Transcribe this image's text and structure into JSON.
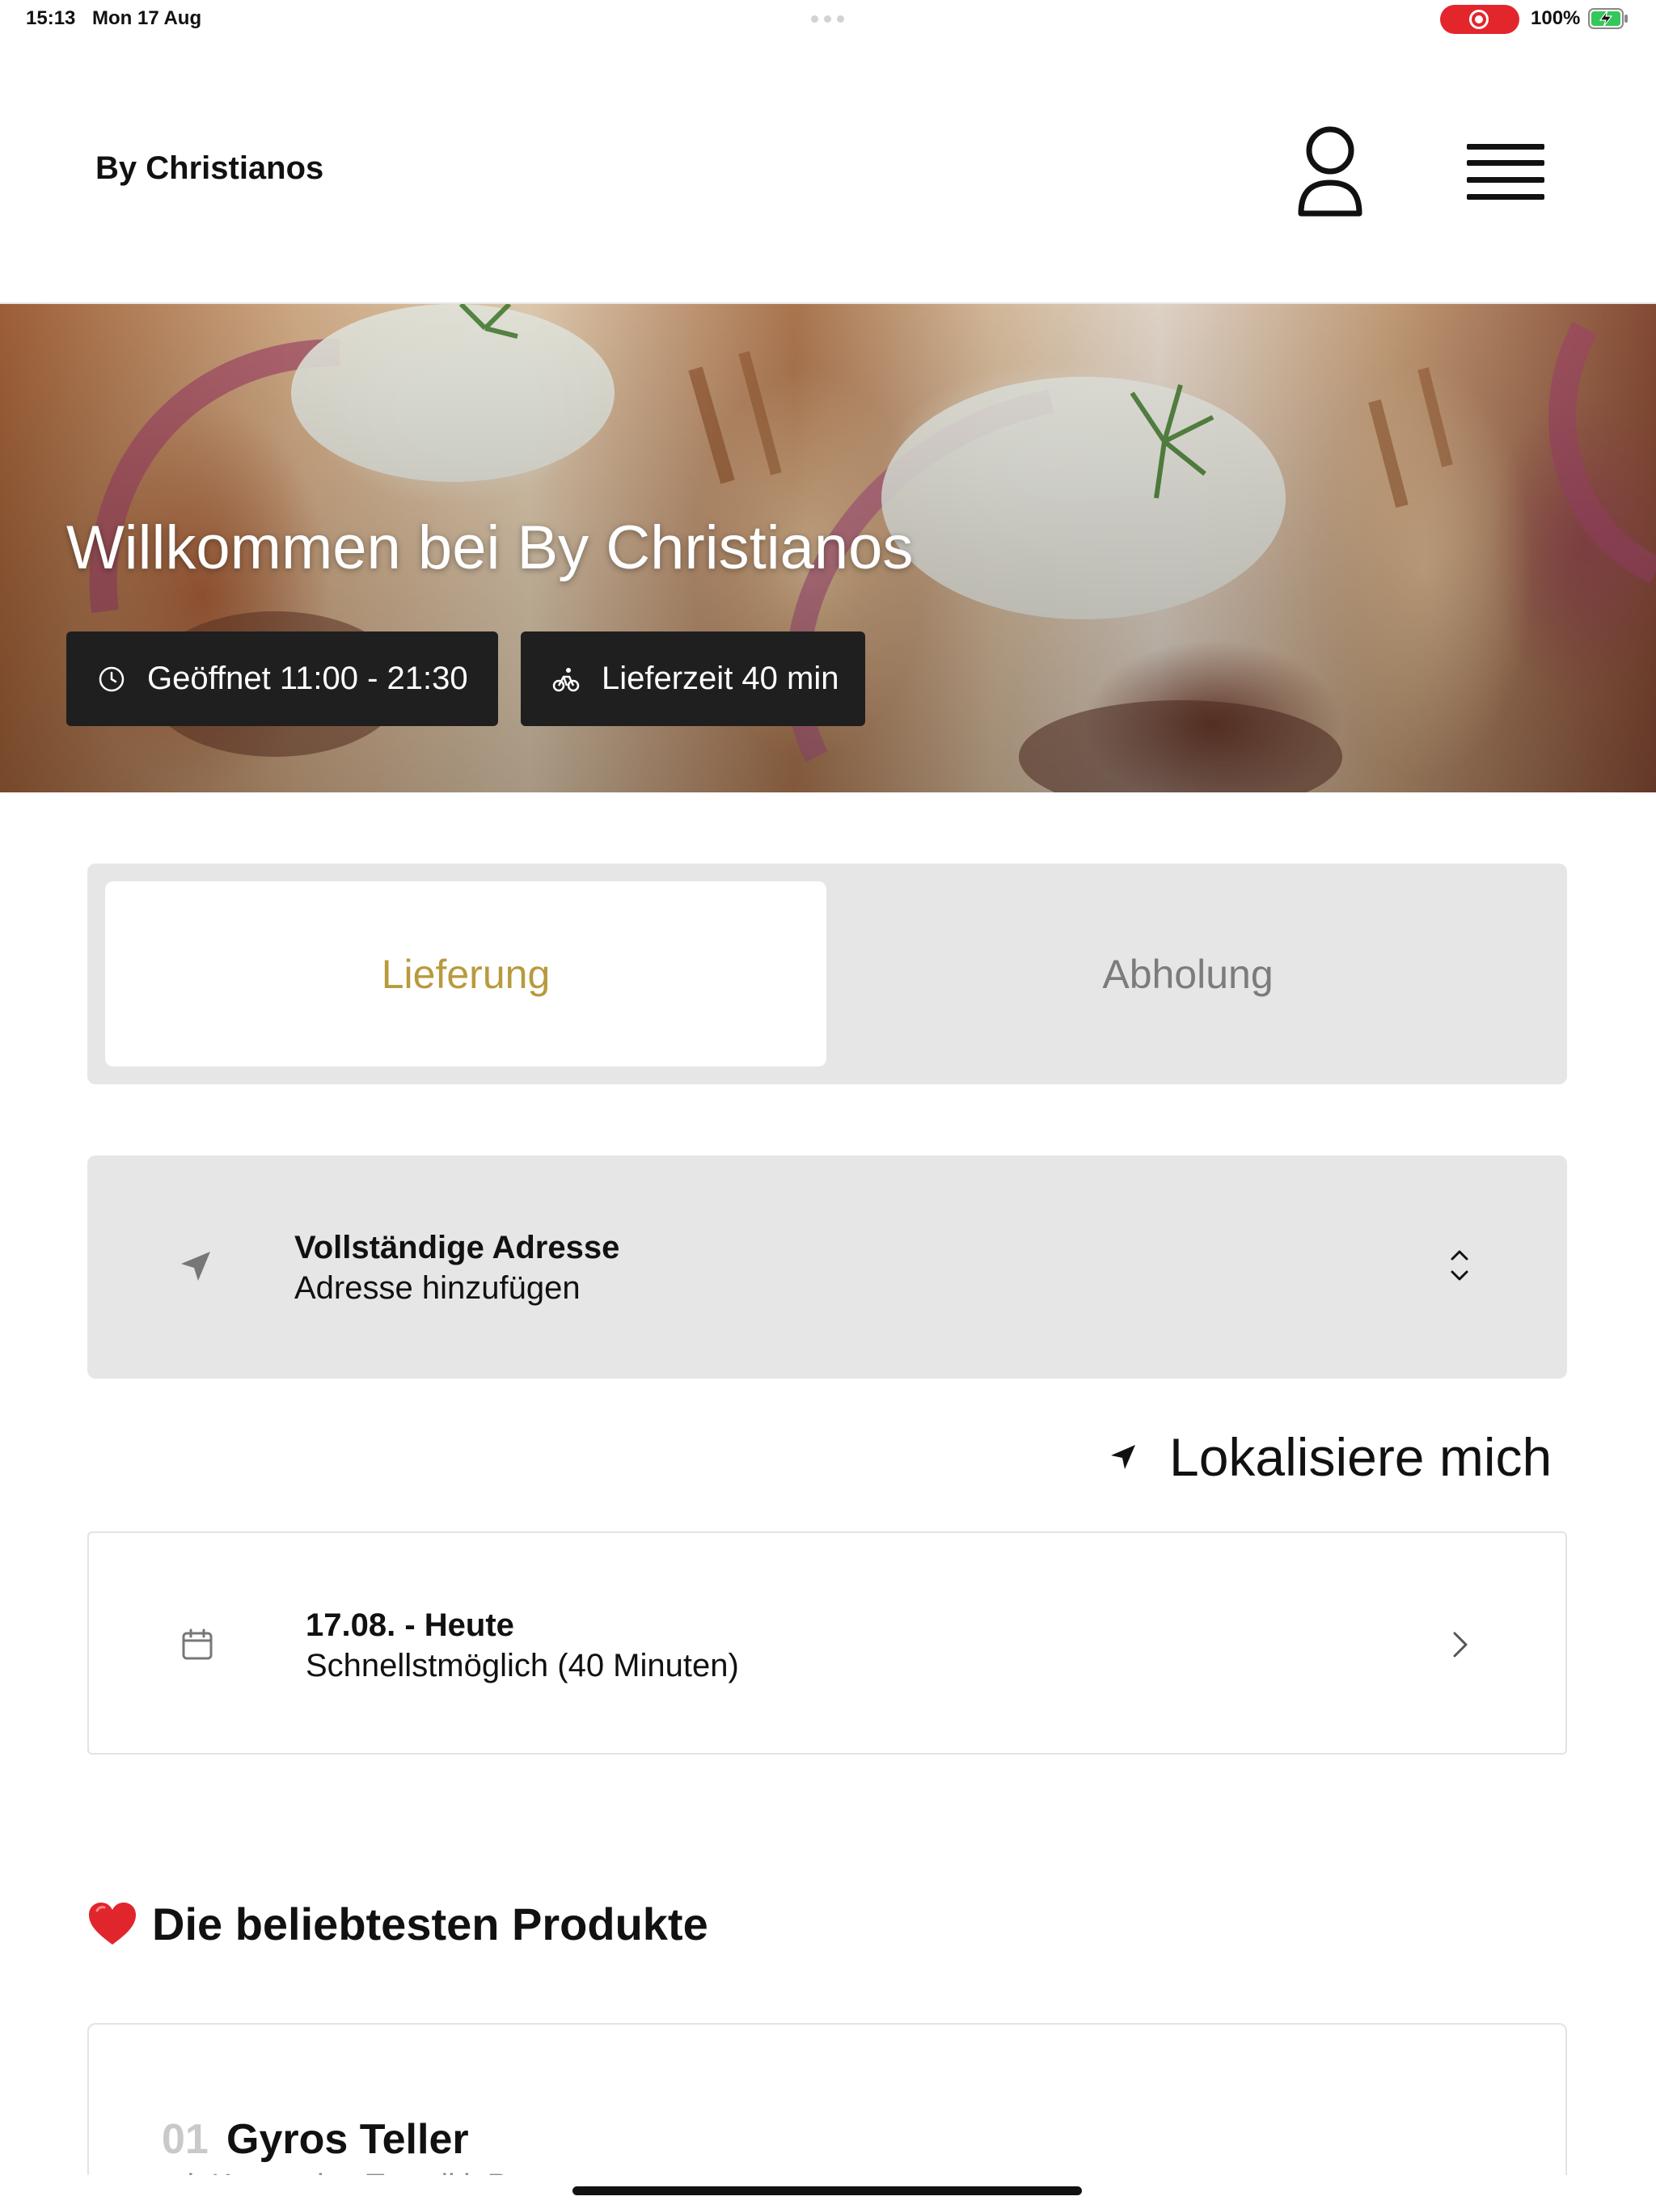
{
  "status_bar": {
    "time": "15:13",
    "date": "Mon 17 Aug",
    "battery_percent": "100%",
    "recording_color": "#e3262c",
    "battery_charging_color": "#34c759"
  },
  "header": {
    "brand": "By Christianos",
    "profile_icon": "person-outline-icon",
    "menu_icon": "hamburger-menu-icon"
  },
  "hero": {
    "title": "Willkommen bei By Christianos",
    "opening_hours": "Geöffnet 11:00 - 21:30",
    "delivery_time": "Lieferzeit 40 min",
    "opening_icon": "clock-icon",
    "delivery_icon": "bicycle-icon"
  },
  "order_mode": {
    "tabs": [
      {
        "label": "Lieferung",
        "active": true
      },
      {
        "label": "Abholung",
        "active": false
      }
    ],
    "accent_color": "#b89a3e"
  },
  "address": {
    "title": "Vollständige Adresse",
    "subtitle": "Adresse hinzufügen",
    "icon": "navigation-arrow-icon",
    "expand_icon": "chevron-up-down-icon"
  },
  "locate": {
    "label": "Lokalisiere mich",
    "icon": "location-arrow-icon"
  },
  "delivery_date": {
    "title": "17.08. - Heute",
    "subtitle": "Schnellstmöglich (40 Minuten)",
    "icon": "calendar-icon",
    "chevron": "chevron-right-icon"
  },
  "popular": {
    "heading": "Die beliebtesten Produkte",
    "icon": "red-heart-icon",
    "products": [
      {
        "number": "01",
        "name": "Gyros Teller",
        "description": "mit Krautsalat, Tzatziki, Pommes"
      }
    ]
  }
}
